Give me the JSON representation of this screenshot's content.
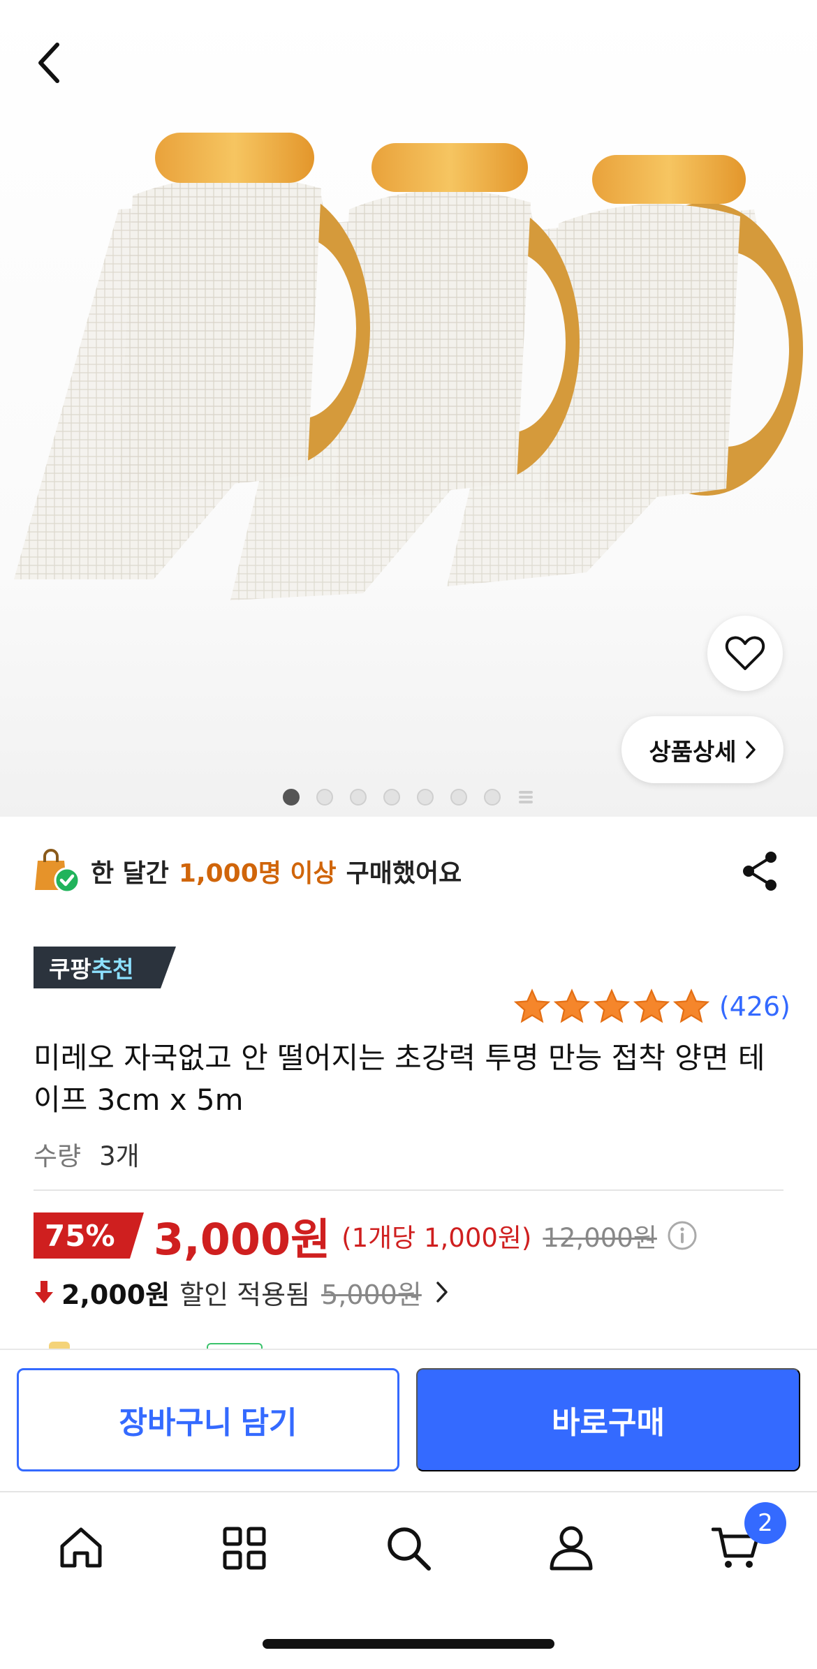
{
  "gallery": {
    "product_image": "double-sided-mesh-tape-rolls",
    "dots_total": 7,
    "active_index": 0,
    "detail_label": "상품상세"
  },
  "buyers": {
    "prefix": "한 달간",
    "highlight": "1,000명 이상",
    "suffix": "구매했어요"
  },
  "badge": {
    "part1": "쿠팡",
    "part2": "추천"
  },
  "rating": {
    "stars": 5,
    "count": "(426)"
  },
  "product": {
    "title": "미레오 자국없고 안 떨어지는 초강력 투명 만능 접착 양면 테이프 3cm x 5m",
    "qty_label": "수량",
    "qty_value": "3개"
  },
  "price": {
    "discount": "75%",
    "sale": "3,000원",
    "unit": "(1개당 1,000원)",
    "original": "12,000원"
  },
  "coupon": {
    "amount": "2,000원",
    "text": "할인 적용됨",
    "old": "5,000원"
  },
  "actions": {
    "cart_label": "장바구니 담기",
    "buy_label": "바로구매"
  },
  "tabbar": {
    "cart_badge": "2"
  },
  "colors": {
    "accent": "#346aff",
    "price": "#cf1f1f",
    "highlight": "#d0650a",
    "star": "#f5862b"
  }
}
